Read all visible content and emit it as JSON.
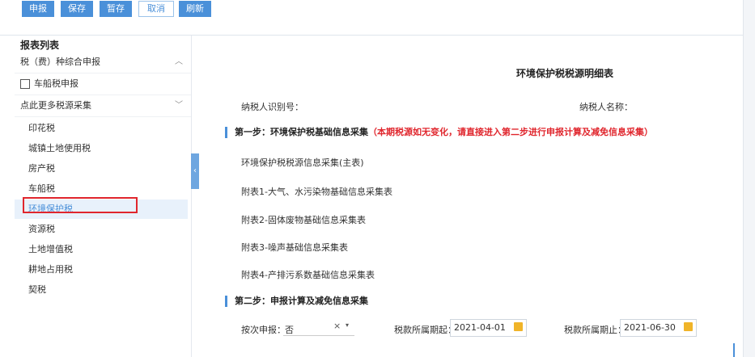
{
  "toolbar": {
    "buttons": [
      {
        "label": "申报"
      },
      {
        "label": "保存"
      },
      {
        "label": "暂存"
      },
      {
        "label": "取消"
      },
      {
        "label": "刷新"
      }
    ]
  },
  "sidebar": {
    "title": "报表列表",
    "group1": "税（费）种综合申报",
    "checkbox_label": "车船税申报",
    "group2": "点此更多税源采集",
    "items": [
      "印花税",
      "城镇土地使用税",
      "房产税",
      "车船税",
      "环境保护税",
      "资源税",
      "土地增值税",
      "耕地占用税",
      "契税"
    ],
    "active_index": 4
  },
  "main": {
    "title": "环境保护税税源明细表",
    "taxpayer_id_label": "纳税人识别号：",
    "taxpayer_name_label": "纳税人名称：",
    "step1": {
      "title": "第一步：环境保护税基础信息采集",
      "note": "（本期税源如无变化，请直接进入第二步进行申报计算及减免信息采集）"
    },
    "links": [
      "环境保护税税源信息采集(主表)",
      "附表1-大气、水污染物基础信息采集表",
      "附表2-固体废物基础信息采集表",
      "附表3-噪声基础信息采集表",
      "附表4-产排污系数基础信息采集表"
    ],
    "step2": {
      "title": "第二步：申报计算及减免信息采集"
    },
    "by_time_label": "按次申报：",
    "by_time_value": "否",
    "clear_glyph": "×",
    "dropdown_glyph": "▾",
    "period_start_label": "税款所属期起：",
    "period_start_value": "2021-04-01",
    "period_end_label": "税款所属期止：",
    "period_end_value": "2021-06-30"
  },
  "icons": {
    "collapse": "‹",
    "chevron_up": "︿",
    "chevron_down": "﹀"
  }
}
